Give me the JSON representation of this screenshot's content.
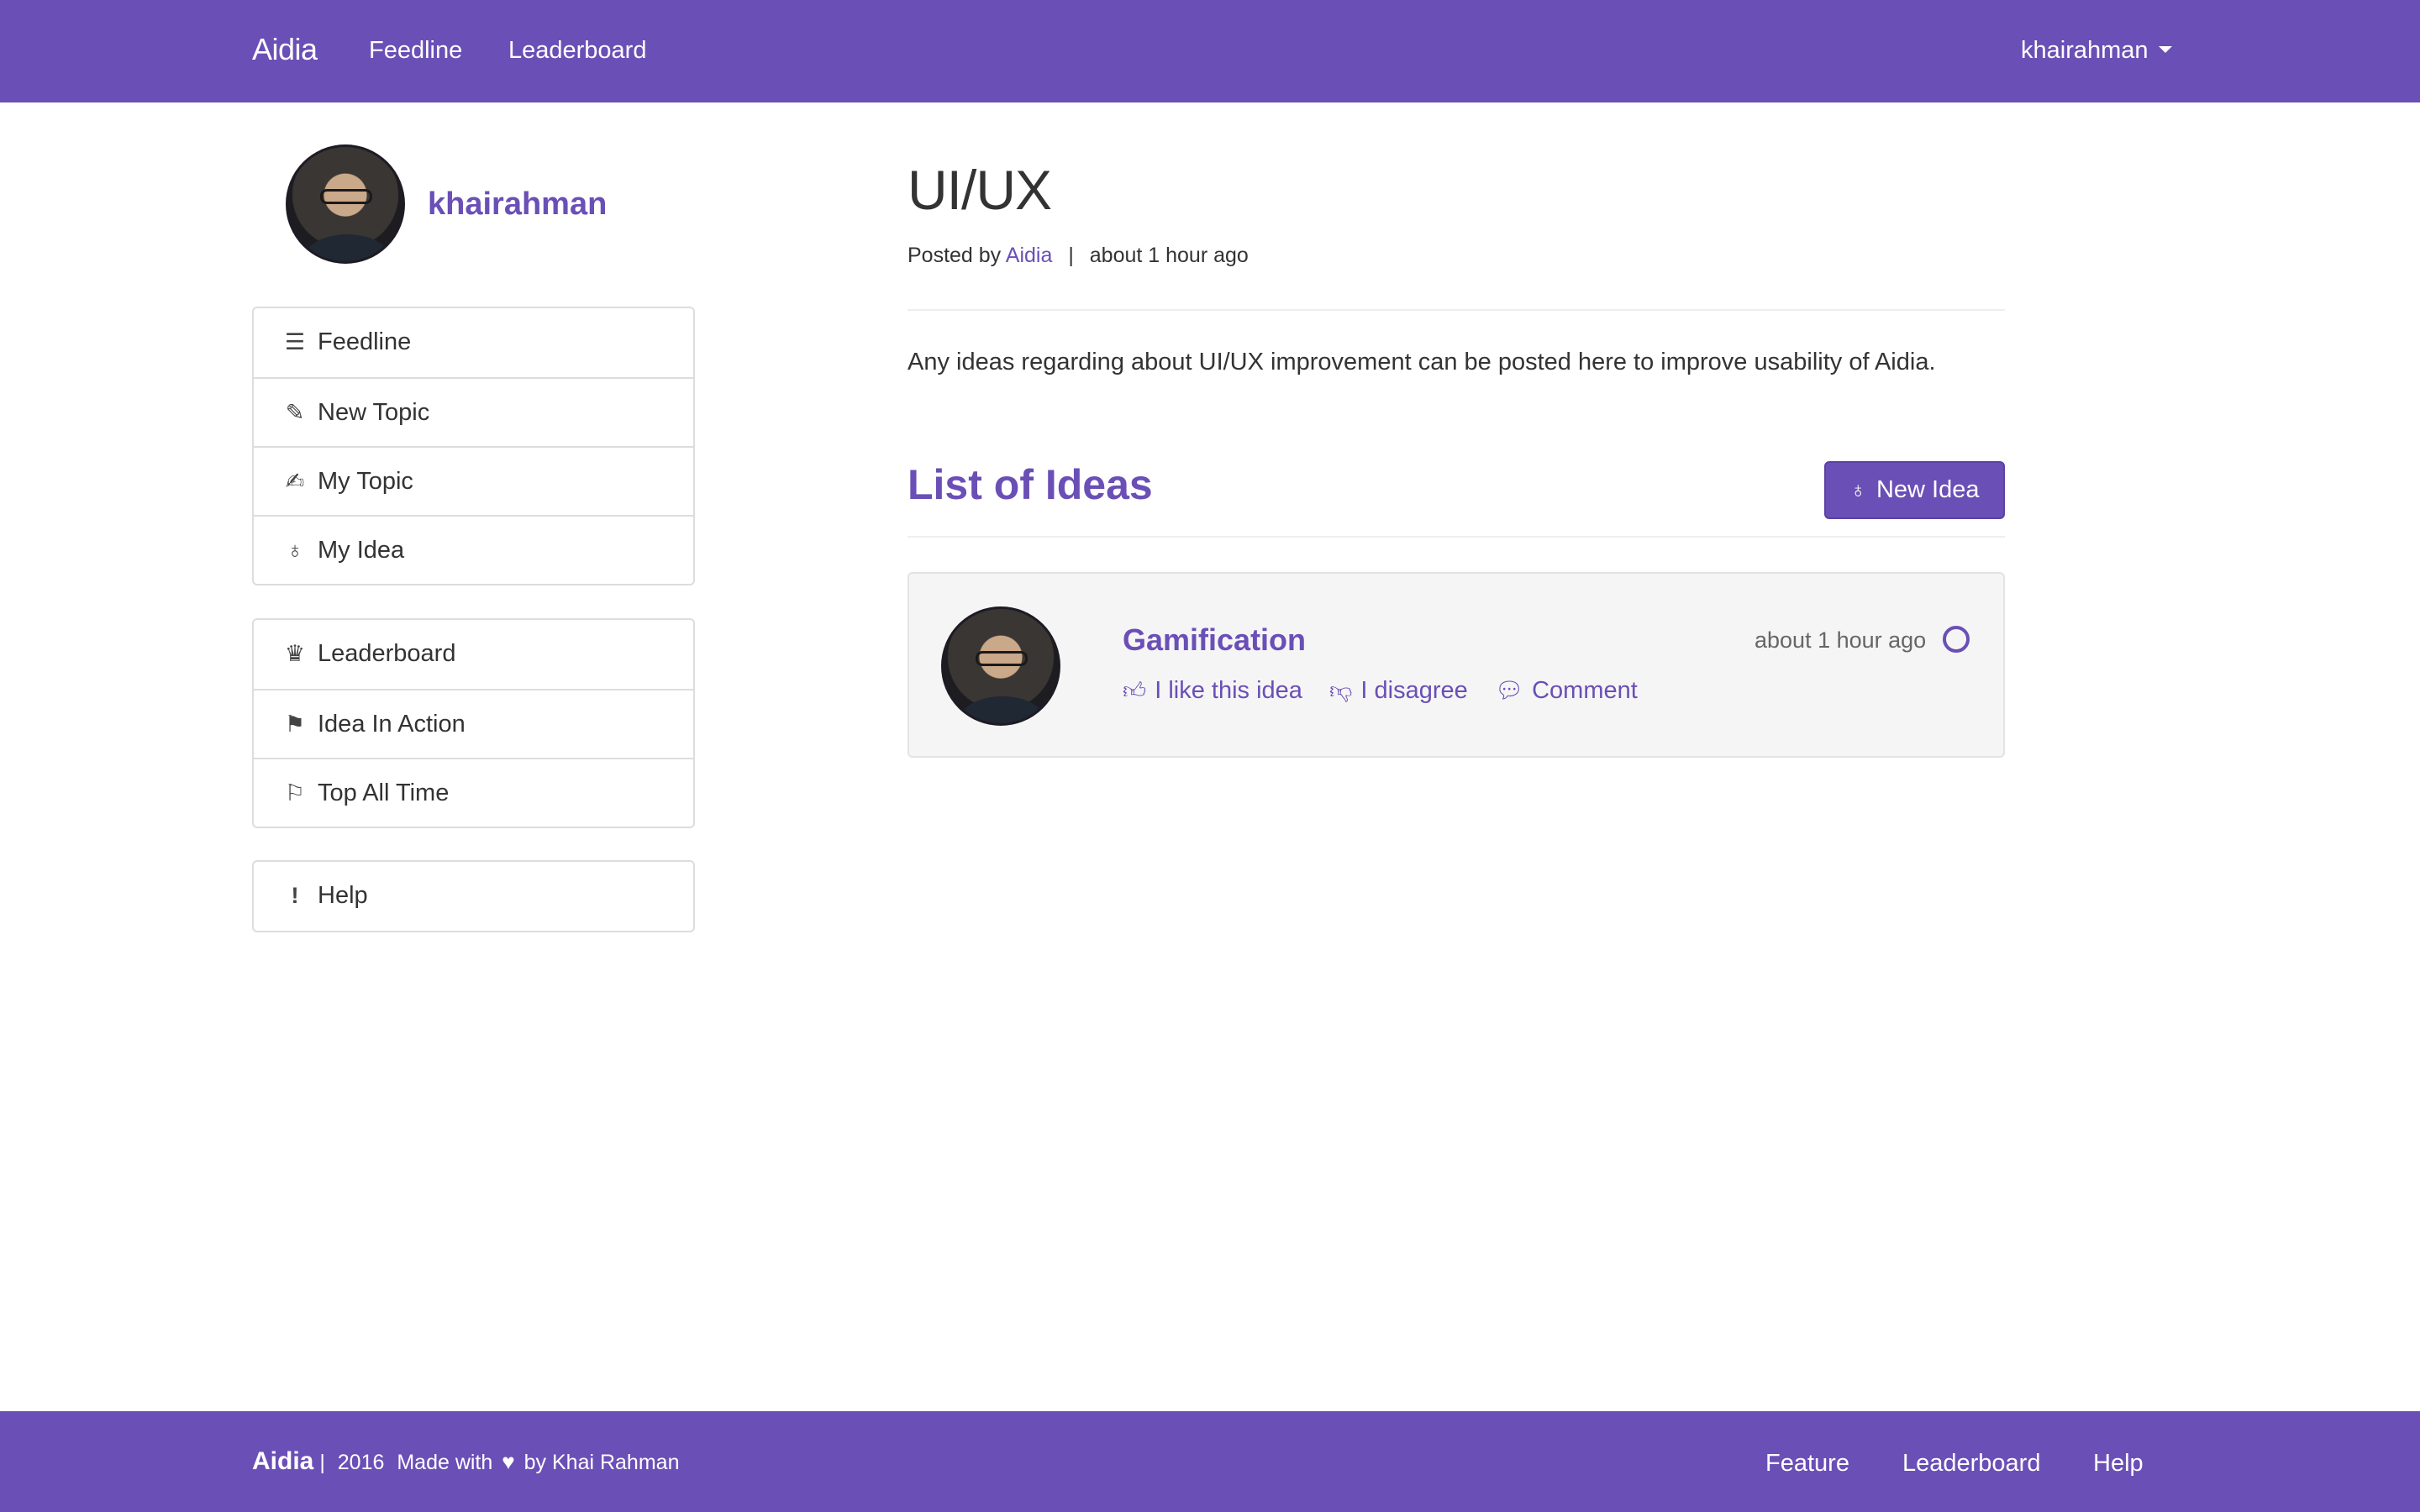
{
  "colors": {
    "brand": "#6a4fb6",
    "text": "#333333",
    "muted": "#666666",
    "card_bg": "#f5f5f5",
    "border": "#dddddd"
  },
  "navbar": {
    "brand": "Aidia",
    "links": [
      "Feedline",
      "Leaderboard"
    ],
    "user": "khairahman"
  },
  "sidebar": {
    "username": "khairahman",
    "groups": [
      {
        "items": [
          {
            "icon": "list-icon",
            "label": "Feedline"
          },
          {
            "icon": "pencil-icon",
            "label": "New Topic"
          },
          {
            "icon": "edit-icon",
            "label": "My Topic"
          },
          {
            "icon": "lightbulb-icon",
            "label": "My Idea"
          }
        ]
      },
      {
        "items": [
          {
            "icon": "trophy-icon",
            "label": "Leaderboard"
          },
          {
            "icon": "flag-icon",
            "label": "Idea In Action"
          },
          {
            "icon": "checkered-flag-icon",
            "label": "Top All Time"
          }
        ]
      },
      {
        "items": [
          {
            "icon": "exclamation-icon",
            "label": "Help"
          }
        ]
      }
    ]
  },
  "topic": {
    "title": "UI/UX",
    "posted_by_prefix": "Posted by",
    "author": "Aidia",
    "separator": "|",
    "time": "about 1 hour ago",
    "description": "Any ideas regarding about UI/UX improvement can be posted here to improve usability of Aidia."
  },
  "ideas": {
    "heading": "List of Ideas",
    "new_button_label": "New Idea",
    "new_button_icon": "lightbulb-icon",
    "items": [
      {
        "title": "Gamification",
        "time": "about 1 hour ago",
        "status_icon": "circle-outline-icon",
        "actions": [
          {
            "icon": "thumbs-up-icon",
            "label": "I like this idea"
          },
          {
            "icon": "thumbs-down-icon",
            "label": "I disagree"
          },
          {
            "icon": "comment-icon",
            "label": "Comment"
          }
        ]
      }
    ]
  },
  "footer": {
    "brand": "Aidia",
    "separator": "|",
    "year": "2016",
    "made_with": "Made with",
    "by": "by Khai Rahman",
    "links": [
      "Feature",
      "Leaderboard",
      "Help"
    ]
  }
}
